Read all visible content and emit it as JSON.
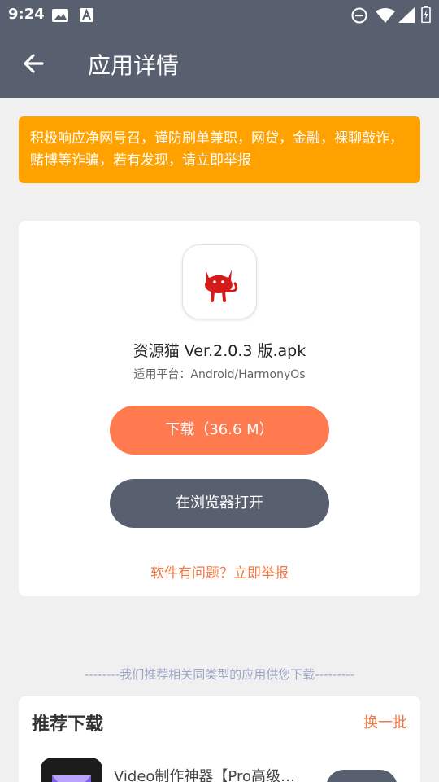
{
  "status_bar": {
    "time": "9:24",
    "left_icons": [
      "image-icon",
      "text-a-icon"
    ],
    "right_icons": [
      "do-not-disturb-icon",
      "wifi-icon",
      "signal-icon",
      "battery-icon"
    ]
  },
  "app_bar": {
    "back_icon": "arrow-back-icon",
    "title": "应用详情"
  },
  "warning": {
    "text": "积极响应净网号召，谨防刷单兼职，网贷，金融，裸聊敲诈，赌博等诈骗，若有发现，请立即举报",
    "color": "#ffa200"
  },
  "app": {
    "icon": "red-cat-icon",
    "name": "资源猫 Ver.2.0.3 版.apk",
    "platform": "适用平台：Android/HarmonyOs"
  },
  "actions": {
    "download_label": "下载（36.6 M）",
    "download_color": "#ff7b4f",
    "browser_label": "在浏览器打开",
    "browser_color": "#585f6e",
    "report_label": "软件有问题？立即举报"
  },
  "recommend": {
    "note": "--------我们推荐相关同类型的应用供您下载---------",
    "title": "推荐下载",
    "refresh_label": "换一批",
    "items": [
      {
        "name": "Video制作神器【Pro高级…",
        "icon": "video-maker-icon"
      }
    ]
  }
}
